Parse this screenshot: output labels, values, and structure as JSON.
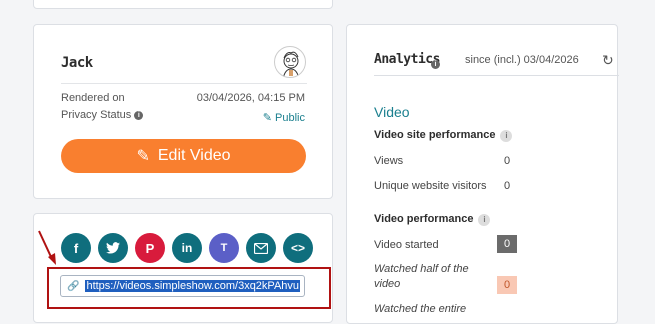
{
  "user_card": {
    "name": "Jack",
    "rendered_label": "Rendered on",
    "rendered_value": "03/04/2026, 04:15 PM",
    "privacy_label": "Privacy Status",
    "privacy_value": "Public",
    "edit_button": "Edit Video"
  },
  "share": {
    "buttons": [
      "facebook-icon",
      "twitter-icon",
      "pinterest-icon",
      "linkedin-icon",
      "teams-icon",
      "email-icon",
      "embed-icon"
    ],
    "colors": [
      "#0f6e7d",
      "#0f6e7d",
      "#d81b3c",
      "#0f6e7d",
      "#5b5fc7",
      "#0f6e7d",
      "#0f6e7d"
    ],
    "url": "https://videos.simpleshow.com/3xq2kPAhvu"
  },
  "analytics": {
    "title": "Analytics",
    "since": "since (incl.) 03/04/2026",
    "section": "Video",
    "site_perf_title": "Video site performance",
    "views_label": "Views",
    "views_value": "0",
    "visitors_label": "Unique website visitors",
    "visitors_value": "0",
    "video_perf_title": "Video performance",
    "started_label": "Video started",
    "started_value": "0",
    "half_label_1": "Watched half of the",
    "half_label_2": "video",
    "half_value": "0",
    "entire_label": "Watched the entire"
  },
  "colors": {
    "accent": "#f97f2f",
    "teal": "#1a7f8e",
    "url_highlight": "#1f5fbf",
    "annotation_red": "#b01212",
    "started_box": "#6b6b6b",
    "half_box": "#f9c8b4"
  }
}
